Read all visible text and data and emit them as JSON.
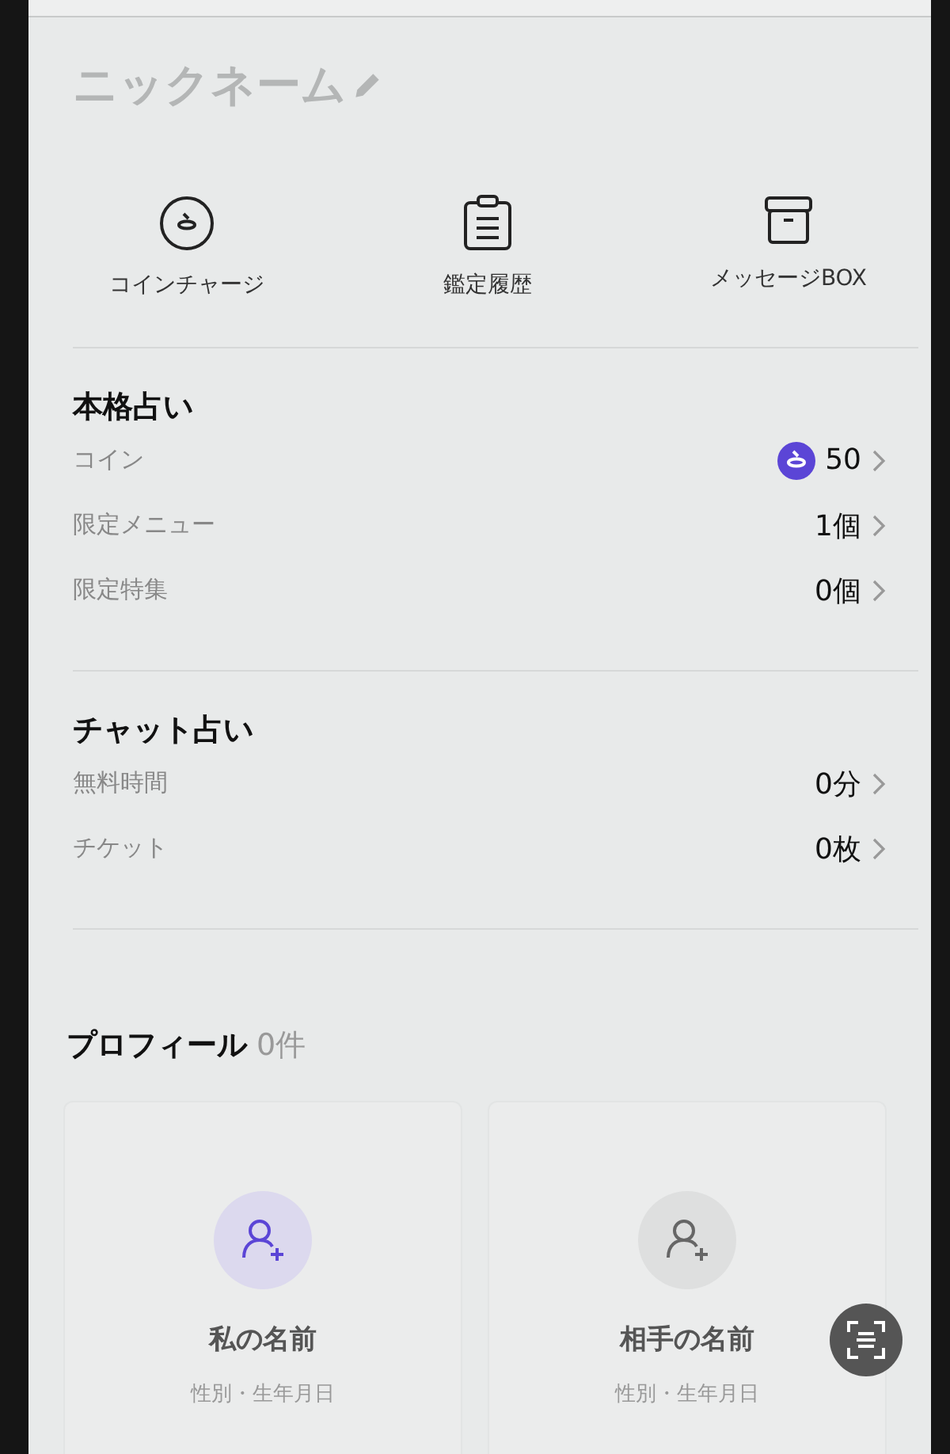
{
  "nickname": "ニックネーム",
  "shortcuts": [
    {
      "kind": "coin",
      "label": "コインチャージ"
    },
    {
      "kind": "clipboard",
      "label": "鑑定履歴"
    },
    {
      "kind": "box",
      "label": "メッセージBOX"
    }
  ],
  "sections": [
    {
      "title": "本格占い",
      "rows": [
        {
          "kind": "coin",
          "label": "コイン",
          "value": "50"
        },
        {
          "kind": "plain",
          "label": "限定メニュー",
          "value": "1個"
        },
        {
          "kind": "plain",
          "label": "限定特集",
          "value": "0個"
        }
      ]
    },
    {
      "title": "チャット占い",
      "rows": [
        {
          "kind": "plain",
          "label": "無料時間",
          "value": "0分"
        },
        {
          "kind": "plain",
          "label": "チケット",
          "value": "0枚"
        }
      ]
    }
  ],
  "profile": {
    "title": "プロフィール",
    "count": "0件",
    "cards": [
      {
        "kind": "self",
        "name": "私の名前",
        "detail": "性別・生年月日"
      },
      {
        "kind": "partner",
        "name": "相手の名前",
        "detail": "性別・生年月日"
      }
    ]
  }
}
